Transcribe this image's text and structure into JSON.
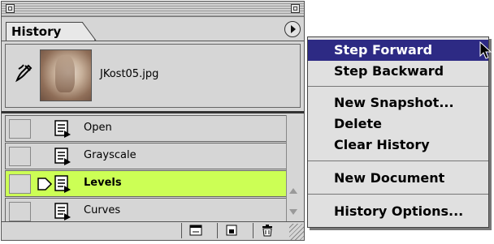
{
  "palette": {
    "tab_label": "History",
    "snapshot": {
      "filename": "JKost05.jpg"
    },
    "history_items": [
      {
        "label": "Open",
        "selected": false
      },
      {
        "label": "Grayscale",
        "selected": false
      },
      {
        "label": "Levels",
        "selected": true
      },
      {
        "label": "Curves",
        "selected": false
      }
    ],
    "bottom_buttons": [
      "new-document-from-state-icon",
      "new-snapshot-icon",
      "trash-icon"
    ]
  },
  "menu": {
    "items": [
      {
        "label": "Step Forward",
        "highlighted": true
      },
      {
        "label": "Step Backward"
      },
      {
        "label": "New Snapshot..."
      },
      {
        "label": "Delete"
      },
      {
        "label": "Clear History"
      },
      {
        "label": "New Document"
      },
      {
        "label": "History Options..."
      }
    ]
  },
  "colors": {
    "selected_row": "#ccff55",
    "menu_highlight": "#2d2a84"
  }
}
